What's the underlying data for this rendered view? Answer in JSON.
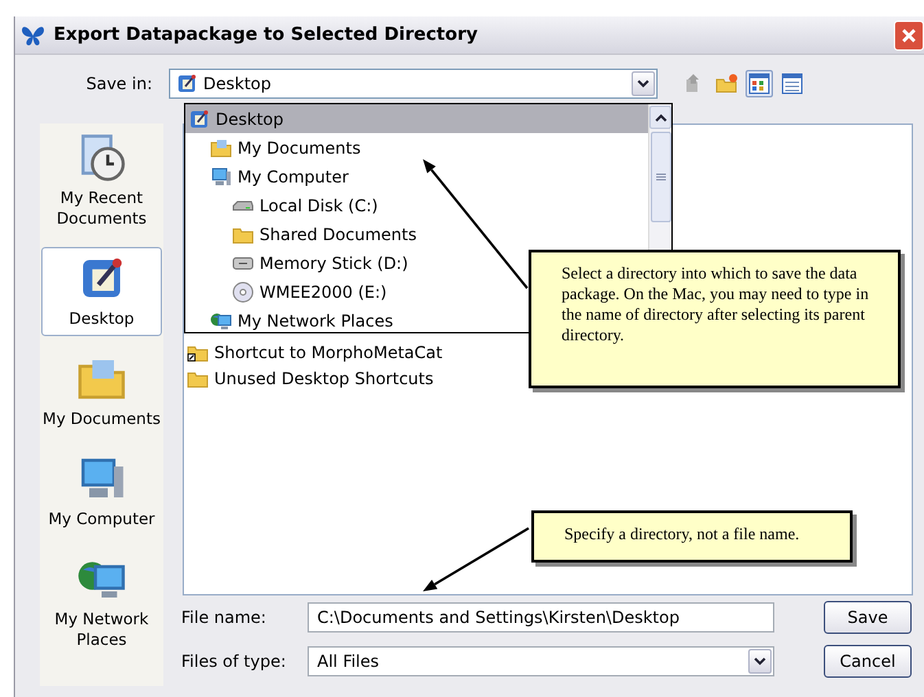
{
  "window": {
    "title": "Export Datapackage to Selected Directory"
  },
  "save_in": {
    "label": "Save in:",
    "value": "Desktop",
    "kind": "desktop"
  },
  "views": [
    {
      "kind": "list",
      "selected": true
    },
    {
      "kind": "details",
      "selected": false
    }
  ],
  "places": [
    {
      "label": "My Recent Documents",
      "kind": "recent",
      "selected": false
    },
    {
      "label": "Desktop",
      "kind": "desktop",
      "selected": true
    },
    {
      "label": "My Documents",
      "kind": "documents",
      "selected": false
    },
    {
      "label": "My Computer",
      "kind": "computer",
      "selected": false
    },
    {
      "label": "My Network Places",
      "kind": "network",
      "selected": false
    }
  ],
  "dropdown": {
    "items": [
      {
        "label": "Desktop",
        "kind": "desktop",
        "selected": true,
        "children": [
          {
            "label": "My Documents",
            "kind": "documents",
            "selected": false
          },
          {
            "label": "My Computer",
            "kind": "computer",
            "selected": false,
            "children": [
              {
                "label": "Local Disk (C:)",
                "kind": "disk",
                "selected": false
              },
              {
                "label": "Shared Documents",
                "kind": "folder",
                "selected": false
              },
              {
                "label": "Memory Stick (D:)",
                "kind": "stick",
                "selected": false
              },
              {
                "label": "WMEE2000 (E:)",
                "kind": "cd",
                "selected": false
              }
            ]
          },
          {
            "label": "My Network Places",
            "kind": "network",
            "selected": false
          }
        ]
      }
    ]
  },
  "files": [
    {
      "label": "Shortcut to MorphoMetaCat",
      "kind": "shortcut"
    },
    {
      "label": "Unused Desktop Shortcuts",
      "kind": "folder"
    }
  ],
  "file_name": {
    "label": "File name:",
    "value": "C:\\Documents and Settings\\Kirsten\\Desktop"
  },
  "file_type": {
    "label": "Files of type:",
    "value": "All Files"
  },
  "buttons": [
    "Save",
    "Cancel"
  ],
  "callouts": [
    {
      "text": "Select a directory into which to save the data package. On the Mac, you may need to type in the name of directory after selecting its parent directory."
    },
    {
      "text": "Specify a directory, not a file name."
    }
  ]
}
